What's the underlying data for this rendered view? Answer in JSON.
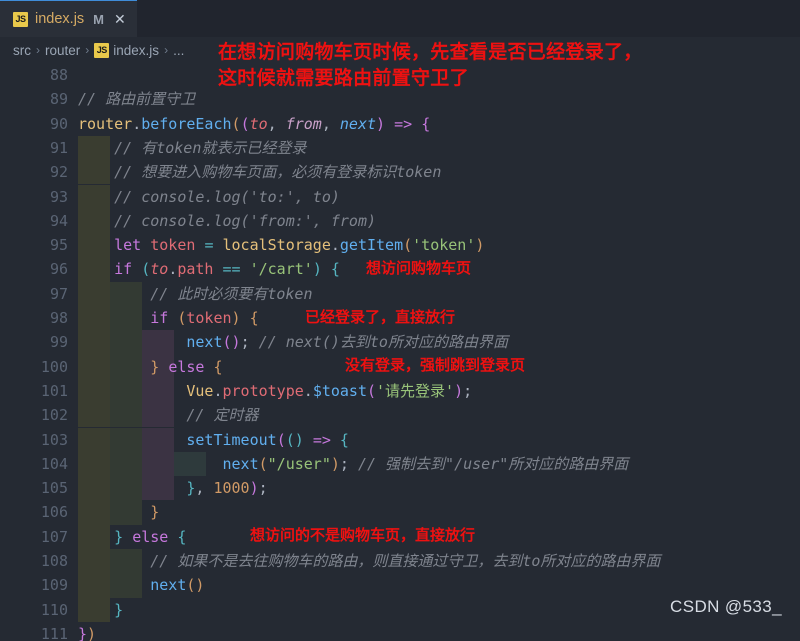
{
  "window": {
    "background": "#252a33"
  },
  "tabbar": {
    "tabs": [
      {
        "icon": "js-file-icon",
        "icon_label": "JS",
        "name": "index.js",
        "dirty_badge": "M",
        "close_label": "✕"
      }
    ]
  },
  "breadcrumb": {
    "separator": "›",
    "items": [
      {
        "label": "src"
      },
      {
        "label": "router"
      },
      {
        "label": "index.js",
        "icon": "js-file-icon",
        "icon_label": "JS"
      },
      {
        "label": "..."
      }
    ]
  },
  "annotations": {
    "header_line1": "在想访问购物车页时候，先查看是否已经登录了，",
    "header_line2": "这时候就需要路由前置守卫了",
    "line96": "想访问购物车页",
    "line98": "已经登录了，直接放行",
    "line100": "没有登录，强制跳到登录页",
    "line107": "想访问的不是购物车页，直接放行"
  },
  "watermark": {
    "text": "CSDN @533_"
  },
  "editor": {
    "first_line_number": 88,
    "lines": [
      {
        "n": "88",
        "text": ""
      },
      {
        "n": "89",
        "text": "// 路由前置守卫"
      },
      {
        "n": "90",
        "text": "router.beforeEach((to, from, next) => {"
      },
      {
        "n": "91",
        "text": "    // 有token就表示已经登录"
      },
      {
        "n": "92",
        "text": "    // 想要进入购物车页面，必须有登录标识token"
      },
      {
        "n": "93",
        "text": "    // console.log('to:', to)"
      },
      {
        "n": "94",
        "text": "    // console.log('from:', from)"
      },
      {
        "n": "95",
        "text": "    let token = localStorage.getItem('token')"
      },
      {
        "n": "96",
        "text": "    if (to.path == '/cart') {"
      },
      {
        "n": "97",
        "text": "        // 此时必须要有token"
      },
      {
        "n": "98",
        "text": "        if (token) {"
      },
      {
        "n": "99",
        "text": "            next(); // next()去到to所对应的路由界面"
      },
      {
        "n": "100",
        "text": "        } else {"
      },
      {
        "n": "101",
        "text": "            Vue.prototype.$toast('请先登录');"
      },
      {
        "n": "102",
        "text": "            // 定时器"
      },
      {
        "n": "103",
        "text": "            setTimeout(() => {"
      },
      {
        "n": "104",
        "text": "                next(\"/user\"); // 强制去到\"/user\"所对应的路由界面"
      },
      {
        "n": "105",
        "text": "            }, 1000);"
      },
      {
        "n": "106",
        "text": "        }"
      },
      {
        "n": "107",
        "text": "    } else {"
      },
      {
        "n": "108",
        "text": "        // 如果不是去往购物车的路由，则直接通过守卫，去到to所对应的路由界面"
      },
      {
        "n": "109",
        "text": "        next()"
      },
      {
        "n": "110",
        "text": "    }"
      },
      {
        "n": "111",
        "text": "})"
      }
    ]
  },
  "colors": {
    "editor_background": "#252a33",
    "tab_background": "#21252e",
    "line_number": "#5a6474",
    "comment": "#7f848e",
    "keyword": "#c678dd",
    "function": "#61afef",
    "object": "#e5c07b",
    "property": "#e06c75",
    "string": "#98c379",
    "number": "#d19a66",
    "annotation_red": "#ee1111"
  }
}
